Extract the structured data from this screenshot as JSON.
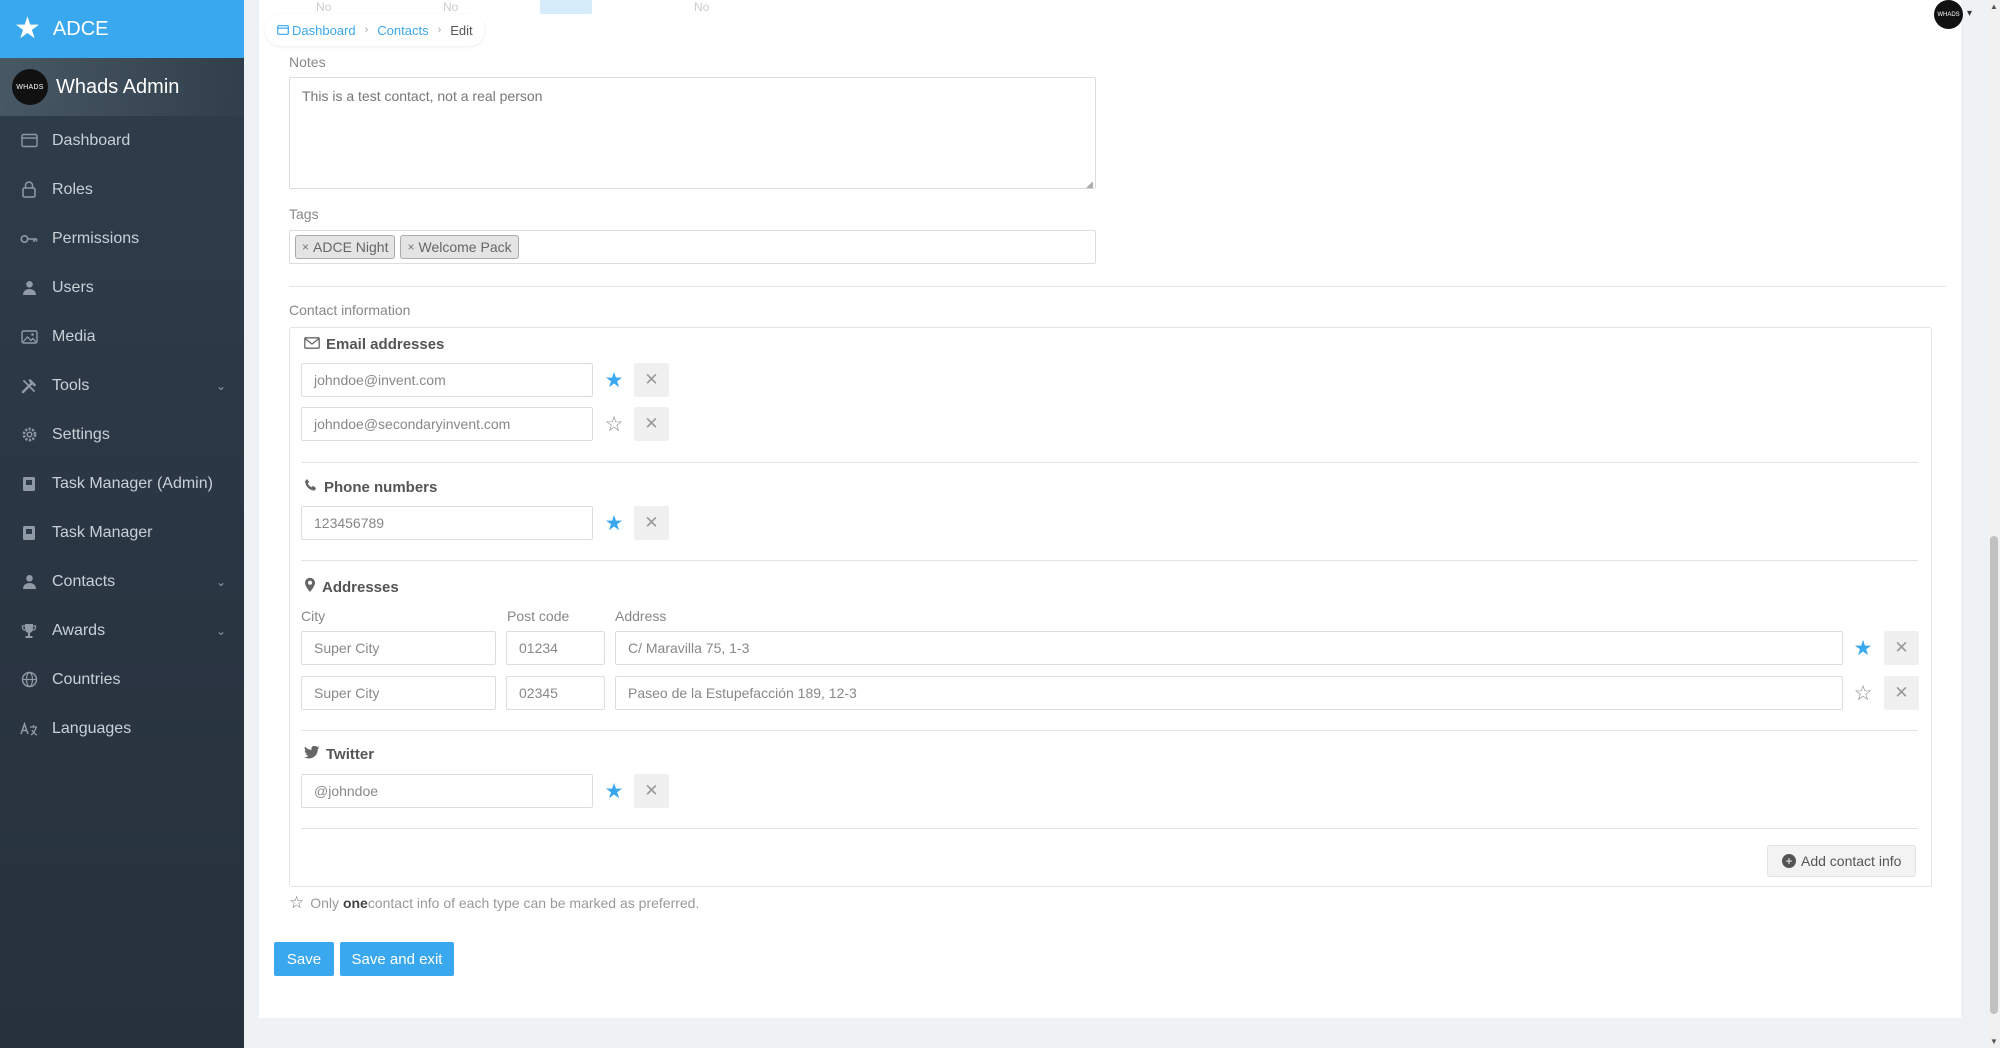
{
  "app": {
    "brand": "ADCE",
    "user_name": "Whads Admin",
    "avatar_text": "WHADS"
  },
  "sidebar": {
    "items": [
      {
        "label": "Dashboard",
        "icon": "dashboard-icon",
        "chevron": false
      },
      {
        "label": "Roles",
        "icon": "lock-icon",
        "chevron": false
      },
      {
        "label": "Permissions",
        "icon": "key-icon",
        "chevron": false
      },
      {
        "label": "Users",
        "icon": "user-icon",
        "chevron": false
      },
      {
        "label": "Media",
        "icon": "image-icon",
        "chevron": false
      },
      {
        "label": "Tools",
        "icon": "tools-icon",
        "chevron": true
      },
      {
        "label": "Settings",
        "icon": "gear-icon",
        "chevron": false
      },
      {
        "label": "Task Manager (Admin)",
        "icon": "book-icon",
        "chevron": false
      },
      {
        "label": "Task Manager",
        "icon": "book-icon",
        "chevron": false
      },
      {
        "label": "Contacts",
        "icon": "user-icon",
        "chevron": true
      },
      {
        "label": "Awards",
        "icon": "trophy-icon",
        "chevron": true
      },
      {
        "label": "Countries",
        "icon": "globe-icon",
        "chevron": false
      },
      {
        "label": "Languages",
        "icon": "language-icon",
        "chevron": false
      }
    ]
  },
  "breadcrumb": {
    "home": "Dashboard",
    "section": "Contacts",
    "current": "Edit"
  },
  "ghost": {
    "a": "No",
    "b": "No",
    "c": "No"
  },
  "form": {
    "notes_label": "Notes",
    "notes_value": "This is a test contact, not a real person",
    "tags_label": "Tags",
    "tags": [
      "ADCE Night",
      "Welcome Pack"
    ],
    "tag_remove": "×",
    "contact_info_label": "Contact information"
  },
  "contact": {
    "emails": {
      "title": "Email addresses",
      "rows": [
        {
          "value": "johndoe@invent.com",
          "preferred": true
        },
        {
          "value": "johndoe@secondaryinvent.com",
          "preferred": false
        }
      ]
    },
    "phones": {
      "title": "Phone numbers",
      "rows": [
        {
          "value": "123456789",
          "preferred": true
        }
      ]
    },
    "addresses": {
      "title": "Addresses",
      "col_city": "City",
      "col_post": "Post code",
      "col_address": "Address",
      "rows": [
        {
          "city": "Super City",
          "post": "01234",
          "address": "C/ Maravilla 75, 1-3",
          "preferred": true
        },
        {
          "city": "Super City",
          "post": "02345",
          "address": "Paseo de la Estupefacción 189, 12-3",
          "preferred": false
        }
      ]
    },
    "twitter": {
      "title": "Twitter",
      "rows": [
        {
          "value": "@johndoe",
          "preferred": true
        }
      ]
    },
    "add_label": "Add contact info"
  },
  "note": {
    "prefix": "Only ",
    "bold": "one",
    "suffix": "contact info of each type can be marked as preferred."
  },
  "buttons": {
    "save": "Save",
    "save_exit": "Save and exit"
  },
  "glyphs": {
    "star_on": "★",
    "star_off": "☆",
    "remove": "✕",
    "plus": "+"
  },
  "colors": {
    "accent": "#3aa8ee",
    "sidebar": "#2d3a48"
  }
}
